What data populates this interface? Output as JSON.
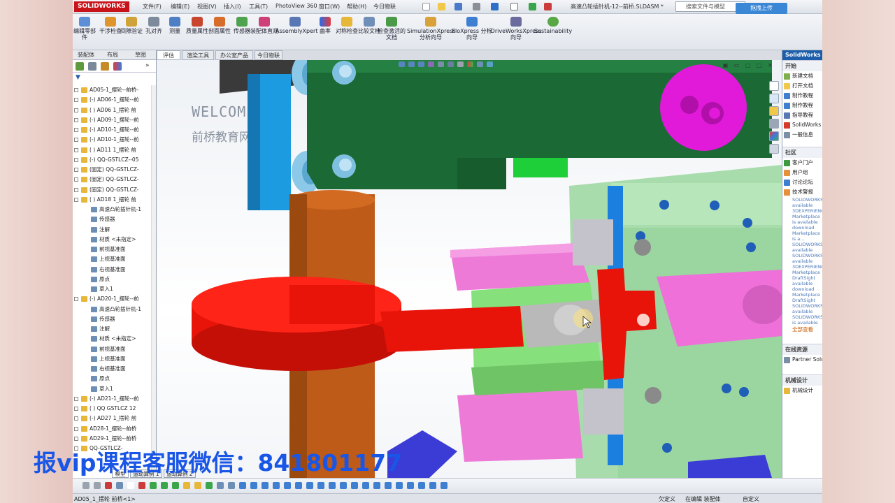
{
  "titlebar": {
    "logo": "SOLIDWORKS",
    "menus": [
      "文件(F)",
      "编辑(E)",
      "视图(V)",
      "插入(I)",
      "工具(T)",
      "PhotoView 360",
      "窗口(W)",
      "帮助(H)",
      "今日物联"
    ],
    "doc_title": "高速凸轮插针机-12--前桥.SLDASM *",
    "search_placeholder": "搜索文件与模型",
    "upload_label": "拖拽上传"
  },
  "ribbon": {
    "buttons": [
      "编辑零部件",
      "干涉检查",
      "间隙验证",
      "孔对齐",
      "测量",
      "质量属性",
      "剖面属性",
      "传感器",
      "装配体直观",
      "AssemblyXpert",
      "曲率",
      "对称检查",
      "比较文档",
      "检查激活的文档",
      "SimulationXpress 分析向导",
      "FloXpress 分析向导",
      "DriveWorksXpress 向导",
      "Sustainability"
    ]
  },
  "cm_tabs": [
    "评估",
    "渲染工具",
    "办公室产品",
    "今日物联"
  ],
  "left_panel": {
    "tabs": [
      "装配体",
      "布局",
      "草图"
    ],
    "tree": [
      {
        "label": "AD05-1_摆轮--前桥-",
        "type": "part"
      },
      {
        "label": "(-) AD06-1_摆轮--前",
        "type": "part"
      },
      {
        "label": "( ) AD06 1_摆轮 前",
        "type": "part"
      },
      {
        "label": "(-) AD09-1_摆轮--前",
        "type": "part"
      },
      {
        "label": "(-) AD10-1_摆轮--前",
        "type": "part"
      },
      {
        "label": "(-) AD10-1_摆轮--前",
        "type": "part"
      },
      {
        "label": "( ) AD11 1_摆轮 前",
        "type": "part"
      },
      {
        "label": "(-) QQ-GSTLCZ--05",
        "type": "part"
      },
      {
        "label": "(固定) QQ-GSTLCZ-",
        "type": "part"
      },
      {
        "label": "(固定) QQ-GSTLCZ-",
        "type": "part"
      },
      {
        "label": "(固定) QQ-GSTLCZ-",
        "type": "part"
      },
      {
        "label": "( ) AD18 1_摆轮 前",
        "type": "part"
      },
      {
        "label": "高速凸轮插针机-1",
        "type": "child"
      },
      {
        "label": "传感器",
        "type": "child"
      },
      {
        "label": "注解",
        "type": "child"
      },
      {
        "label": "材质 <未指定>",
        "type": "child"
      },
      {
        "label": "前视基准面",
        "type": "child"
      },
      {
        "label": "上视基准面",
        "type": "child"
      },
      {
        "label": "右视基准面",
        "type": "child"
      },
      {
        "label": "原点",
        "type": "child"
      },
      {
        "label": "草入1",
        "type": "child"
      },
      {
        "label": "(-) AD20-1_摆轮--前",
        "type": "part"
      },
      {
        "label": "高速凸轮插针机-1",
        "type": "child"
      },
      {
        "label": "传感器",
        "type": "child"
      },
      {
        "label": "注解",
        "type": "child"
      },
      {
        "label": "材质 <未指定>",
        "type": "child"
      },
      {
        "label": "前视基准面",
        "type": "child"
      },
      {
        "label": "上视基准面",
        "type": "child"
      },
      {
        "label": "右视基准面",
        "type": "child"
      },
      {
        "label": "原点",
        "type": "child"
      },
      {
        "label": "草入1",
        "type": "child"
      },
      {
        "label": "(-) AD21-1_摆轮--前",
        "type": "part"
      },
      {
        "label": "( ) QQ GSTLCZ 12",
        "type": "part"
      },
      {
        "label": "(-) AD27 1_摆轮 前",
        "type": "part"
      },
      {
        "label": "AD28-1_摆轮--前桥",
        "type": "part"
      },
      {
        "label": "AD29-1_摆轮--前桥",
        "type": "part"
      },
      {
        "label": "QQ-GSTLCZ-",
        "type": "part"
      }
    ]
  },
  "viewport": {
    "welcome": "WELCOM",
    "welcome_sub": "前桥教育网"
  },
  "task_pane": {
    "header": "SolidWorks",
    "start_title": "开始",
    "start_items": [
      "新建文档",
      "打开文档",
      "制作教程",
      "制作教程",
      "指导教程",
      "SolidWorks",
      "一般信息"
    ],
    "community_title": "社区",
    "community_items": [
      "客户门户",
      "用户组",
      "讨论论坛",
      "技术警报"
    ],
    "news": [
      "SOLIDWORKS",
      "available",
      "3DEXPERIENCE",
      "Marketplace",
      "is available",
      "download",
      "Marketplace",
      "is a...",
      "SOLIDWORKS",
      "available",
      "SOLIDWORKS",
      "available",
      "3DEXPERIENCE",
      "Marketplace",
      "DraftSight",
      "available",
      "download",
      "Marketplace",
      "DraftSight",
      "SOLIDWORKS",
      "available",
      "SOLIDWORKS",
      "is available"
    ],
    "more": "全部查看",
    "online_title": "在线资源",
    "online_item": "Partner Solutions",
    "design_title": "机械设计",
    "design_item": "机械设计"
  },
  "bottom_tabs": [
    "模型",
    "运动算例 1",
    "运动算例 2"
  ],
  "status": {
    "left": "AD05_1_摆轮 前桥<1>",
    "mid1": "欠定义",
    "mid2": "在编辑 装配体",
    "right": "自定义"
  },
  "overlay": "报vip课程客服微信：841801177"
}
